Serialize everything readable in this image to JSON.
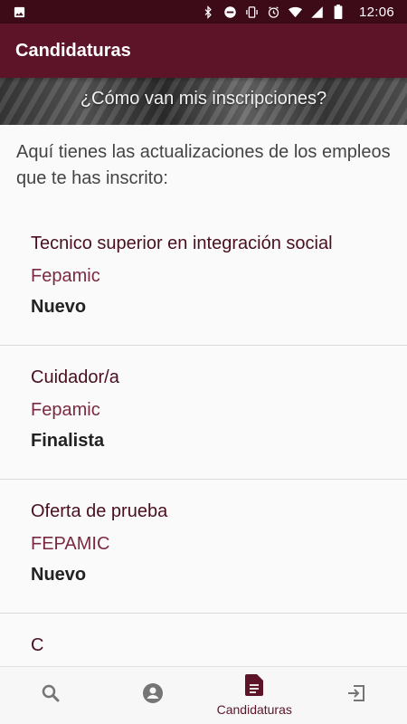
{
  "status_bar": {
    "time": "12:06",
    "icons": [
      "image-icon",
      "bluetooth-icon",
      "do-not-disturb-icon",
      "vibrate-icon",
      "alarm-icon",
      "wifi-icon",
      "signal-icon",
      "battery-icon"
    ]
  },
  "app_bar": {
    "title": "Candidaturas"
  },
  "banner": {
    "text": "¿Cómo van mis inscripciones?"
  },
  "intro": {
    "text": "Aquí tienes las actualizaciones de los empleos que te has inscrito:"
  },
  "applications": [
    {
      "title": "Tecnico superior en integración social",
      "company": "Fepamic",
      "status": "Nuevo"
    },
    {
      "title": "Cuidador/a",
      "company": "Fepamic",
      "status": "Finalista"
    },
    {
      "title": "Oferta de prueba",
      "company": "FEPAMIC",
      "status": "Nuevo"
    },
    {
      "title": "C",
      "company": "",
      "status": ""
    }
  ],
  "bottom_nav": {
    "items": [
      {
        "icon": "search-icon",
        "label": ""
      },
      {
        "icon": "account-icon",
        "label": ""
      },
      {
        "icon": "document-icon",
        "label": "Candidaturas",
        "active": true
      },
      {
        "icon": "exit-icon",
        "label": ""
      }
    ]
  },
  "colors": {
    "primary": "#5e1428",
    "status_bar": "#3d0a18",
    "accent_text": "#4a0f1f"
  }
}
